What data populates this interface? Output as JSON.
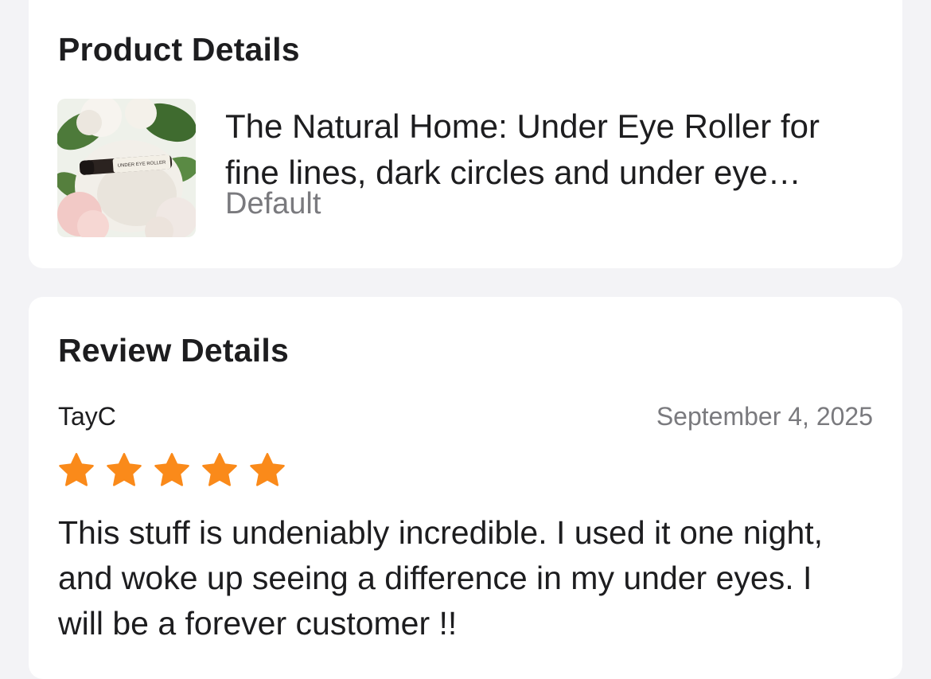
{
  "product_section": {
    "title": "Product Details",
    "product_name": "The Natural Home: Under Eye Roller for fine lines, dark circles and under eye puffiness",
    "variant": "Default",
    "thumbnail_label": "UNDER EYE ROLLER"
  },
  "review_section": {
    "title": "Review Details",
    "reviewer": "TayC",
    "date": "September 4, 2025",
    "rating": 5,
    "rating_max": 5,
    "star_icon": "star-icon",
    "text": "This stuff is undeniably incredible. I used it one night, and woke up seeing a difference in my under eyes. I will be a forever customer !!"
  },
  "colors": {
    "background": "#f3f3f6",
    "card": "#ffffff",
    "text_primary": "#1d1d1f",
    "text_secondary": "#7a7a7e",
    "star": "#fa8a1a"
  }
}
